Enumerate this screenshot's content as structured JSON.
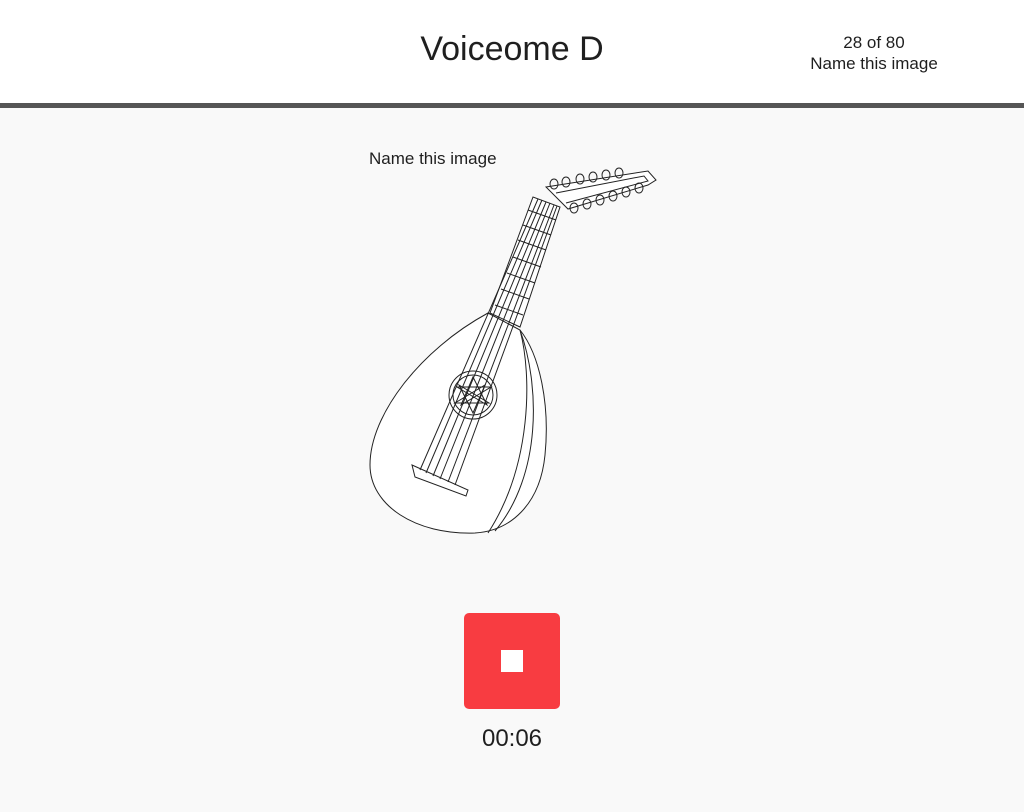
{
  "header": {
    "title": "Voiceome D",
    "progress_count": "28 of 80",
    "progress_task": "Name this image"
  },
  "task": {
    "prompt": "Name this image",
    "image_icon": "lute-drawing"
  },
  "recorder": {
    "button_icon": "stop-icon",
    "button_color": "#f83c41",
    "timer": "00:06"
  }
}
